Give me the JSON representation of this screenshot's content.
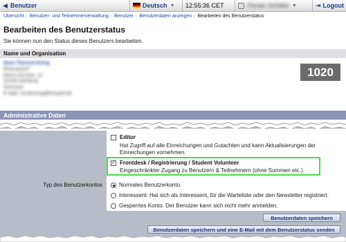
{
  "topbar": {
    "back_label": "Benutzer",
    "language": "Deutsch",
    "clock": "12:55:36 CET",
    "user_name": "Florian Schäfer",
    "logout": "Logout"
  },
  "breadcrumbs": [
    "Übersicht",
    "Benutzer- und Teilnehmerverwaltung",
    "Benutzer",
    "Benutzerdaten anzeigen",
    "Bearbeiten des Benutzerstatus"
  ],
  "page": {
    "title": "Bearbeiten des Benutzerstatus",
    "subtitle": "Sie können nun den Status dieses Benutzers bearbeiten."
  },
  "org": {
    "heading": "Name und Organisation",
    "name": "Nora Theresa König",
    "lines": [
      "Ehrenamt/IT",
      "Kleine Kirchstr. 12",
      "20149 Hamburg",
      "Germany",
      "E-Mail: norakoenig@beispiel.de"
    ],
    "id_number": "1020"
  },
  "admin": {
    "heading": "Administrative Daten",
    "permissions": [
      {
        "title": "Editor",
        "desc": "Hat Zugriff auf alle Einreichungen und Gutachten und kann Aktualisierungen der Einreichungen vornehmen.",
        "checked": false
      },
      {
        "title": "Frontdesk / Registrierung / Student Volunteer",
        "desc": "Eingeschränkter Zugang zu Benutzern & Teilnehmern (ohne Summen etc.).",
        "checked": true
      }
    ],
    "check_mark": "✓",
    "account_type_label": "Typ des Benutzerkontos",
    "account_types": [
      {
        "label": "Normales Benutzerkonto.",
        "selected": true
      },
      {
        "label": "Interessent: Hat sich als Interessent, für die Warteliste oder den Newsletter registriert.",
        "selected": false
      },
      {
        "label": "Gesperrtes Konto: Der Benutzer kann sich nicht mehr anmelden.",
        "selected": false
      }
    ]
  },
  "buttons": {
    "save": "Benutzerdaten speichern",
    "save_and_mail": "Benutzerdaten speichern und eine E-Mail mit dem Benutzerstatus senden"
  },
  "colors": {
    "accent": "#1e3b86",
    "admin_header": "#8a94b7",
    "highlight": "#3ee03e",
    "row_bg": "#b7bcc9"
  }
}
